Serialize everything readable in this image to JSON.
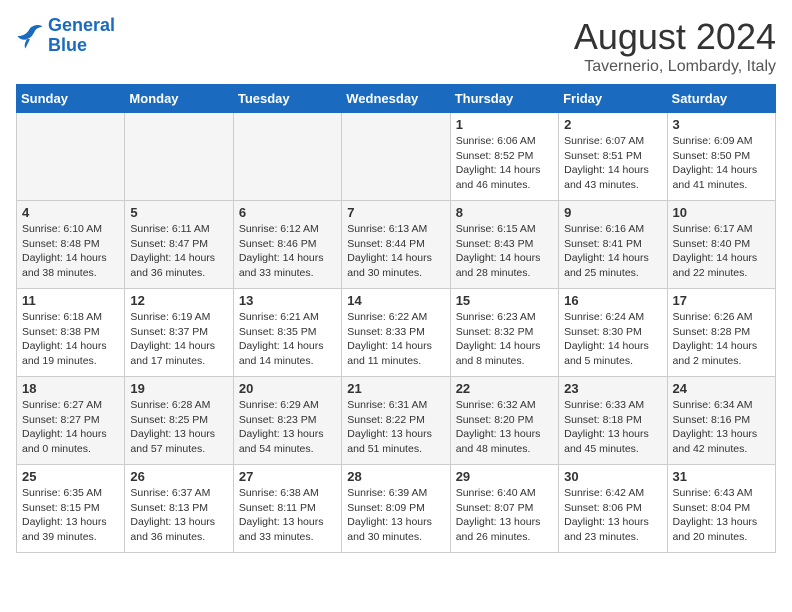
{
  "header": {
    "logo": {
      "line1": "General",
      "line2": "Blue"
    },
    "title": "August 2024",
    "subtitle": "Tavernerio, Lombardy, Italy"
  },
  "days_of_week": [
    "Sunday",
    "Monday",
    "Tuesday",
    "Wednesday",
    "Thursday",
    "Friday",
    "Saturday"
  ],
  "weeks": [
    [
      {
        "day": "",
        "info": ""
      },
      {
        "day": "",
        "info": ""
      },
      {
        "day": "",
        "info": ""
      },
      {
        "day": "",
        "info": ""
      },
      {
        "day": "1",
        "info": "Sunrise: 6:06 AM\nSunset: 8:52 PM\nDaylight: 14 hours and 46 minutes."
      },
      {
        "day": "2",
        "info": "Sunrise: 6:07 AM\nSunset: 8:51 PM\nDaylight: 14 hours and 43 minutes."
      },
      {
        "day": "3",
        "info": "Sunrise: 6:09 AM\nSunset: 8:50 PM\nDaylight: 14 hours and 41 minutes."
      }
    ],
    [
      {
        "day": "4",
        "info": "Sunrise: 6:10 AM\nSunset: 8:48 PM\nDaylight: 14 hours and 38 minutes."
      },
      {
        "day": "5",
        "info": "Sunrise: 6:11 AM\nSunset: 8:47 PM\nDaylight: 14 hours and 36 minutes."
      },
      {
        "day": "6",
        "info": "Sunrise: 6:12 AM\nSunset: 8:46 PM\nDaylight: 14 hours and 33 minutes."
      },
      {
        "day": "7",
        "info": "Sunrise: 6:13 AM\nSunset: 8:44 PM\nDaylight: 14 hours and 30 minutes."
      },
      {
        "day": "8",
        "info": "Sunrise: 6:15 AM\nSunset: 8:43 PM\nDaylight: 14 hours and 28 minutes."
      },
      {
        "day": "9",
        "info": "Sunrise: 6:16 AM\nSunset: 8:41 PM\nDaylight: 14 hours and 25 minutes."
      },
      {
        "day": "10",
        "info": "Sunrise: 6:17 AM\nSunset: 8:40 PM\nDaylight: 14 hours and 22 minutes."
      }
    ],
    [
      {
        "day": "11",
        "info": "Sunrise: 6:18 AM\nSunset: 8:38 PM\nDaylight: 14 hours and 19 minutes."
      },
      {
        "day": "12",
        "info": "Sunrise: 6:19 AM\nSunset: 8:37 PM\nDaylight: 14 hours and 17 minutes."
      },
      {
        "day": "13",
        "info": "Sunrise: 6:21 AM\nSunset: 8:35 PM\nDaylight: 14 hours and 14 minutes."
      },
      {
        "day": "14",
        "info": "Sunrise: 6:22 AM\nSunset: 8:33 PM\nDaylight: 14 hours and 11 minutes."
      },
      {
        "day": "15",
        "info": "Sunrise: 6:23 AM\nSunset: 8:32 PM\nDaylight: 14 hours and 8 minutes."
      },
      {
        "day": "16",
        "info": "Sunrise: 6:24 AM\nSunset: 8:30 PM\nDaylight: 14 hours and 5 minutes."
      },
      {
        "day": "17",
        "info": "Sunrise: 6:26 AM\nSunset: 8:28 PM\nDaylight: 14 hours and 2 minutes."
      }
    ],
    [
      {
        "day": "18",
        "info": "Sunrise: 6:27 AM\nSunset: 8:27 PM\nDaylight: 14 hours and 0 minutes."
      },
      {
        "day": "19",
        "info": "Sunrise: 6:28 AM\nSunset: 8:25 PM\nDaylight: 13 hours and 57 minutes."
      },
      {
        "day": "20",
        "info": "Sunrise: 6:29 AM\nSunset: 8:23 PM\nDaylight: 13 hours and 54 minutes."
      },
      {
        "day": "21",
        "info": "Sunrise: 6:31 AM\nSunset: 8:22 PM\nDaylight: 13 hours and 51 minutes."
      },
      {
        "day": "22",
        "info": "Sunrise: 6:32 AM\nSunset: 8:20 PM\nDaylight: 13 hours and 48 minutes."
      },
      {
        "day": "23",
        "info": "Sunrise: 6:33 AM\nSunset: 8:18 PM\nDaylight: 13 hours and 45 minutes."
      },
      {
        "day": "24",
        "info": "Sunrise: 6:34 AM\nSunset: 8:16 PM\nDaylight: 13 hours and 42 minutes."
      }
    ],
    [
      {
        "day": "25",
        "info": "Sunrise: 6:35 AM\nSunset: 8:15 PM\nDaylight: 13 hours and 39 minutes."
      },
      {
        "day": "26",
        "info": "Sunrise: 6:37 AM\nSunset: 8:13 PM\nDaylight: 13 hours and 36 minutes."
      },
      {
        "day": "27",
        "info": "Sunrise: 6:38 AM\nSunset: 8:11 PM\nDaylight: 13 hours and 33 minutes."
      },
      {
        "day": "28",
        "info": "Sunrise: 6:39 AM\nSunset: 8:09 PM\nDaylight: 13 hours and 30 minutes."
      },
      {
        "day": "29",
        "info": "Sunrise: 6:40 AM\nSunset: 8:07 PM\nDaylight: 13 hours and 26 minutes."
      },
      {
        "day": "30",
        "info": "Sunrise: 6:42 AM\nSunset: 8:06 PM\nDaylight: 13 hours and 23 minutes."
      },
      {
        "day": "31",
        "info": "Sunrise: 6:43 AM\nSunset: 8:04 PM\nDaylight: 13 hours and 20 minutes."
      }
    ]
  ]
}
